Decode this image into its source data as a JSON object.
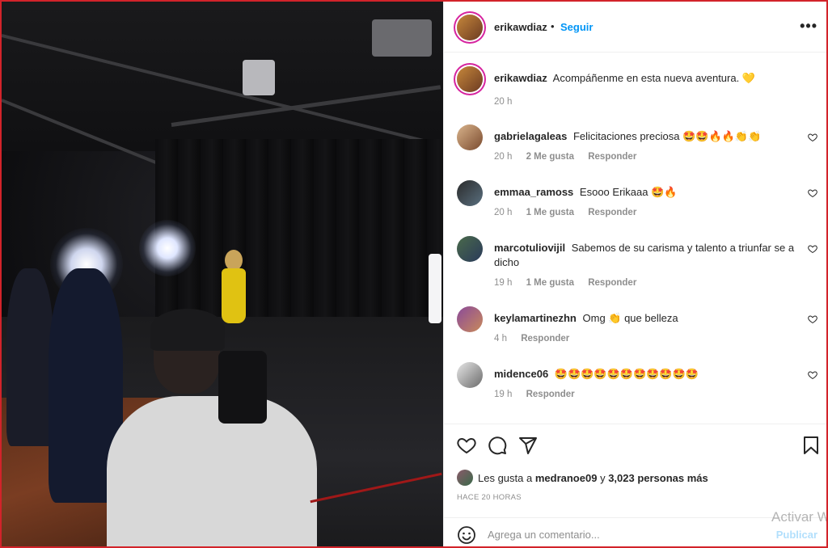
{
  "post": {
    "author": "erikawdiaz",
    "follow_label": "Seguir",
    "more_label": "•••",
    "separator": "•",
    "caption_text": "Acompáñenme en esta nueva aventura. 💛",
    "caption_time": "20 h"
  },
  "comments": [
    {
      "username": "gabrielagaleas",
      "text": "Felicitaciones preciosa 🤩🤩🔥🔥👏👏",
      "time": "20 h",
      "likes": "2 Me gusta",
      "reply": "Responder"
    },
    {
      "username": "emmaa_ramoss",
      "text": "Esooo Erikaaa 🤩🔥",
      "time": "20 h",
      "likes": "1 Me gusta",
      "reply": "Responder"
    },
    {
      "username": "marcotuliovijil",
      "text": "Sabemos de su carisma y talento a triunfar se a dicho",
      "time": "19 h",
      "likes": "1 Me gusta",
      "reply": "Responder"
    },
    {
      "username": "keylamartinezhn",
      "text": "Omg 👏 que belleza",
      "time": "4 h",
      "likes": "",
      "reply": "Responder"
    },
    {
      "username": "midence06",
      "text": "🤩🤩🤩🤩🤩🤩🤩🤩🤩🤩🤩",
      "time": "19 h",
      "likes": "",
      "reply": "Responder"
    }
  ],
  "actions": {
    "likes_prefix": "Les gusta a",
    "likes_user": "medranoe09",
    "likes_mid": "y",
    "likes_count": "3,023 personas más",
    "time_ago": "HACE 20 HORAS"
  },
  "add_comment": {
    "placeholder": "Agrega un comentario...",
    "publish_label": "Publicar"
  },
  "watermark": "Activar W",
  "icons": [
    "heart-icon",
    "comment-icon",
    "share-icon",
    "bookmark-icon",
    "smile-icon",
    "more-icon"
  ],
  "colors": {
    "link": "#0095f6",
    "border": "#d2232a",
    "muted": "#8e8e8e"
  }
}
